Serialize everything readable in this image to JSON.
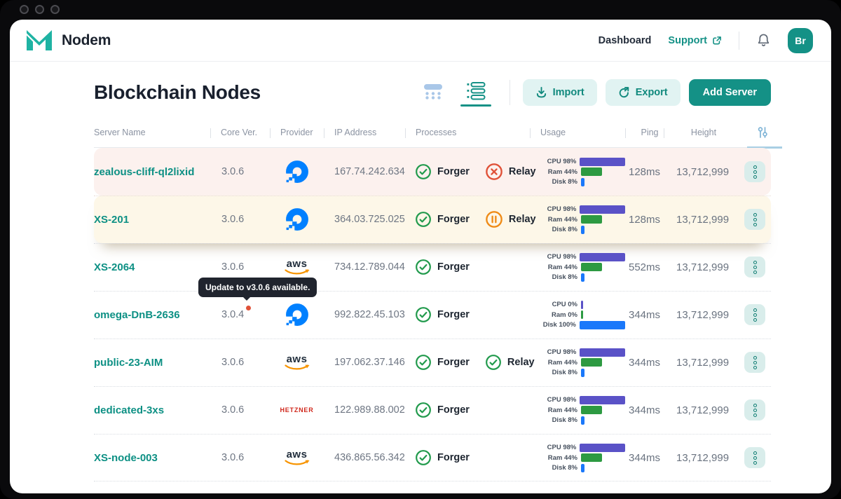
{
  "header": {
    "brand": "Nodem",
    "nav": [
      {
        "id": "dashboard",
        "label": "Dashboard"
      },
      {
        "id": "support",
        "label": "Support"
      }
    ],
    "avatar_initials": "Br"
  },
  "page": {
    "title": "Blockchain Nodes",
    "toolbar": {
      "import": "Import",
      "export": "Export",
      "add_server": "Add Server"
    }
  },
  "table": {
    "columns": [
      "Server Name",
      "Core Ver.",
      "Provider",
      "IP Address",
      "Processes",
      "Usage",
      "Ping",
      "Height"
    ],
    "provider_logos": {
      "aws_text": "aws",
      "hetzner_text": "HETZNER"
    },
    "rows": [
      {
        "name": "zealous-cliff-ql2lixid",
        "version": "3.0.6",
        "provider": "digitalocean",
        "ip": "167.74.242.634",
        "processes": [
          {
            "label": "Forger",
            "status": "ok"
          },
          {
            "label": "Relay",
            "status": "error"
          }
        ],
        "usage": [
          {
            "kind": "cpu",
            "label": "CPU 98%",
            "pct": 98
          },
          {
            "kind": "ram",
            "label": "Ram 44%",
            "pct": 44
          },
          {
            "kind": "disk",
            "label": "Disk 8%",
            "pct": 8
          }
        ],
        "ping": "128ms",
        "height": "13,712,999",
        "highlight": "alert"
      },
      {
        "name": "XS-201",
        "version": "3.0.6",
        "provider": "digitalocean",
        "ip": "364.03.725.025",
        "processes": [
          {
            "label": "Forger",
            "status": "ok"
          },
          {
            "label": "Relay",
            "status": "paused"
          }
        ],
        "usage": [
          {
            "kind": "cpu",
            "label": "CPU 98%",
            "pct": 98
          },
          {
            "kind": "ram",
            "label": "Ram 44%",
            "pct": 44
          },
          {
            "kind": "disk",
            "label": "Disk 8%",
            "pct": 8
          }
        ],
        "ping": "128ms",
        "height": "13,712,999",
        "highlight": "warn"
      },
      {
        "name": "XS-2064",
        "version": "3.0.6",
        "provider": "aws",
        "ip": "734.12.789.044",
        "processes": [
          {
            "label": "Forger",
            "status": "ok"
          }
        ],
        "usage": [
          {
            "kind": "cpu",
            "label": "CPU 98%",
            "pct": 98
          },
          {
            "kind": "ram",
            "label": "Ram 44%",
            "pct": 44
          },
          {
            "kind": "disk",
            "label": "Disk 8%",
            "pct": 8
          }
        ],
        "ping": "552ms",
        "height": "13,712,999",
        "highlight": null
      },
      {
        "name": "omega-DnB-2636",
        "version": "3.0.4",
        "provider": "digitalocean",
        "update_note": "Update to v3.0.6 available.",
        "ip": "992.822.45.103",
        "processes": [
          {
            "label": "Forger",
            "status": "ok"
          }
        ],
        "usage": [
          {
            "kind": "cpu",
            "label": "CPU 0%",
            "pct": 0
          },
          {
            "kind": "ram",
            "label": "Ram 0%",
            "pct": 0
          },
          {
            "kind": "disk",
            "label": "Disk 100%",
            "pct": 100
          }
        ],
        "ping": "344ms",
        "height": "13,712,999",
        "highlight": null
      },
      {
        "name": "public-23-AIM",
        "version": "3.0.6",
        "provider": "aws",
        "ip": "197.062.37.146",
        "processes": [
          {
            "label": "Forger",
            "status": "ok"
          },
          {
            "label": "Relay",
            "status": "ok"
          }
        ],
        "usage": [
          {
            "kind": "cpu",
            "label": "CPU 98%",
            "pct": 98
          },
          {
            "kind": "ram",
            "label": "Ram 44%",
            "pct": 44
          },
          {
            "kind": "disk",
            "label": "Disk 8%",
            "pct": 8
          }
        ],
        "ping": "344ms",
        "height": "13,712,999",
        "highlight": null
      },
      {
        "name": "dedicated-3xs",
        "version": "3.0.6",
        "provider": "hetzner",
        "ip": "122.989.88.002",
        "processes": [
          {
            "label": "Forger",
            "status": "ok"
          }
        ],
        "usage": [
          {
            "kind": "cpu",
            "label": "CPU 98%",
            "pct": 98
          },
          {
            "kind": "ram",
            "label": "Ram 44%",
            "pct": 44
          },
          {
            "kind": "disk",
            "label": "Disk 8%",
            "pct": 8
          }
        ],
        "ping": "344ms",
        "height": "13,712,999",
        "highlight": null
      },
      {
        "name": "XS-node-003",
        "version": "3.0.6",
        "provider": "aws",
        "ip": "436.865.56.342",
        "processes": [
          {
            "label": "Forger",
            "status": "ok"
          }
        ],
        "usage": [
          {
            "kind": "cpu",
            "label": "CPU 98%",
            "pct": 98
          },
          {
            "kind": "ram",
            "label": "Ram 44%",
            "pct": 44
          },
          {
            "kind": "disk",
            "label": "Disk 8%",
            "pct": 8
          }
        ],
        "ping": "344ms",
        "height": "13,712,999",
        "highlight": null
      }
    ]
  },
  "colors": {
    "accent": "#149186",
    "cpu": "#5a52c7",
    "ram": "#2d9a42",
    "disk": "#1a78fa",
    "ok": "#219a4c",
    "err": "#e05138",
    "paused": "#ef8b17",
    "rowAlert": "#fcf1ee",
    "rowWarn": "#fdf7e8"
  }
}
